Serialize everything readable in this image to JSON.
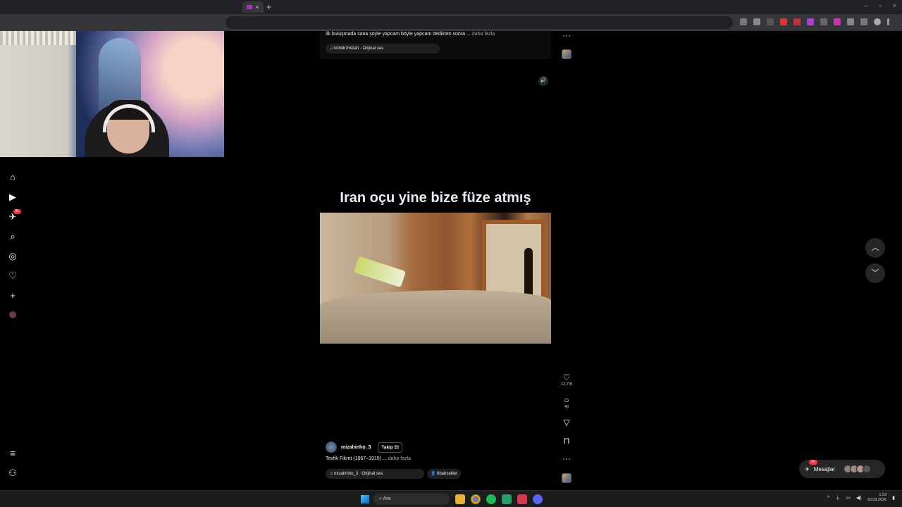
{
  "browser": {
    "tab_close": "×",
    "new_tab": "+",
    "window_controls": [
      "–",
      "▫",
      "×"
    ]
  },
  "nav": {
    "notifications_badge": "9+"
  },
  "previous_post": {
    "caption": "İlk buluşmada sana şöyle yapcam böyle yapcam dedikten sonra ...",
    "more": "daha fazla",
    "audio": "♫ k0mik7mizah · Orijinal ses",
    "more_options": "···"
  },
  "reel": {
    "overlay_text": "Iran oçu yine bize füze atmış",
    "username": "mizahinho_3",
    "follow_label": "Takip Et",
    "caption": "Tevfik Fikret (1867–1915) ...",
    "more": "daha fazla",
    "audio": "♫ mizahinho_3 · Orijinal ses",
    "tagged": "👤 8bahceliler",
    "likes": "12,7 B",
    "comments": "40",
    "more_options": "···"
  },
  "messages": {
    "label": "Mesajlar",
    "badge": "9+"
  },
  "taskbar": {
    "search_placeholder": "Ara",
    "time": "1:53",
    "date": "10.03.2026"
  },
  "colors": {
    "background": "#000000",
    "badge_red": "#ff3040",
    "chrome_dark": "#202124"
  }
}
